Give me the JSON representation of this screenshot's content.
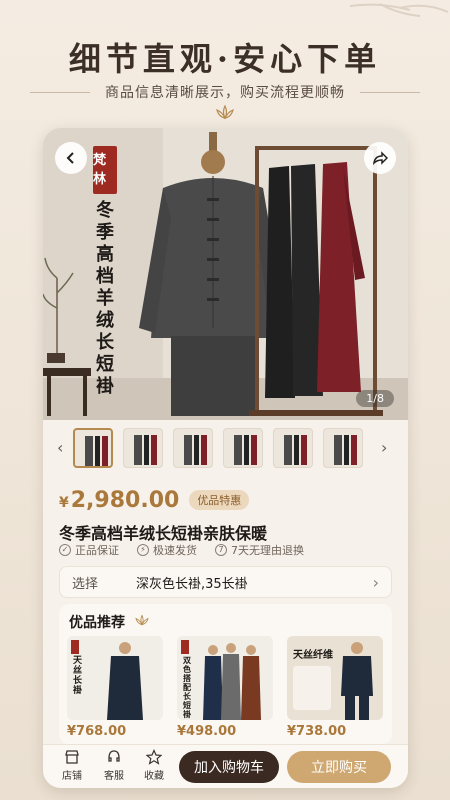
{
  "hero": {
    "title": "细节直观·安心下单",
    "subtitle": "商品信息清晰展示，购买流程更顺畅"
  },
  "photo": {
    "brand": "梵林",
    "vertical_title": "冬季高档羊绒长短褂",
    "counter": "1/8"
  },
  "product": {
    "currency": "¥",
    "price": "2,980.00",
    "price_tag": "优品特惠",
    "title": "冬季高档羊绒长短褂亲肤保暖",
    "guarantees": [
      "正品保证",
      "极速发货",
      "7天无理由退换"
    ]
  },
  "selection": {
    "label": "选择",
    "value": "深灰色长褂,35长褂"
  },
  "recommend": {
    "title": "优品推荐",
    "items": [
      {
        "price": "¥768.00",
        "caption": "天丝长褂"
      },
      {
        "price": "¥498.00",
        "caption": "双色搭配长短褂"
      },
      {
        "price": "¥738.00",
        "caption": "天丝纤维"
      }
    ]
  },
  "bottom_bar": {
    "shop": "店铺",
    "service": "客服",
    "favorite": "收藏",
    "add_cart": "加入购物车",
    "buy_now": "立即购买"
  },
  "colors": {
    "accent": "#a9783a",
    "seal": "#9e2b22",
    "cart_button": "#3a2a22",
    "buy_button": "#cfa771"
  }
}
